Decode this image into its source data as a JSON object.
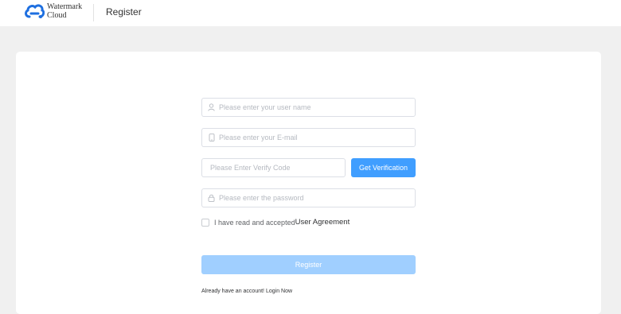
{
  "header": {
    "logo_line1": "Watermark",
    "logo_line2": "Cloud",
    "page_title": "Register",
    "brand_color": "#409eff"
  },
  "form": {
    "username_placeholder": "Please enter your user name",
    "email_placeholder": "Please enter your E-mail",
    "code_placeholder": "Please Enter Verify Code",
    "verify_button": "Get Verification",
    "password_placeholder": "Please enter the password",
    "agree_text": "I have read and accepted",
    "agreement_link": "User Agreement",
    "agree_checked": false,
    "register_button": "Register",
    "login_prompt": "Already have an account!",
    "login_link": "Login Now"
  },
  "icons": {
    "username": "user-icon",
    "email": "phone-icon",
    "password": "lock-icon"
  }
}
